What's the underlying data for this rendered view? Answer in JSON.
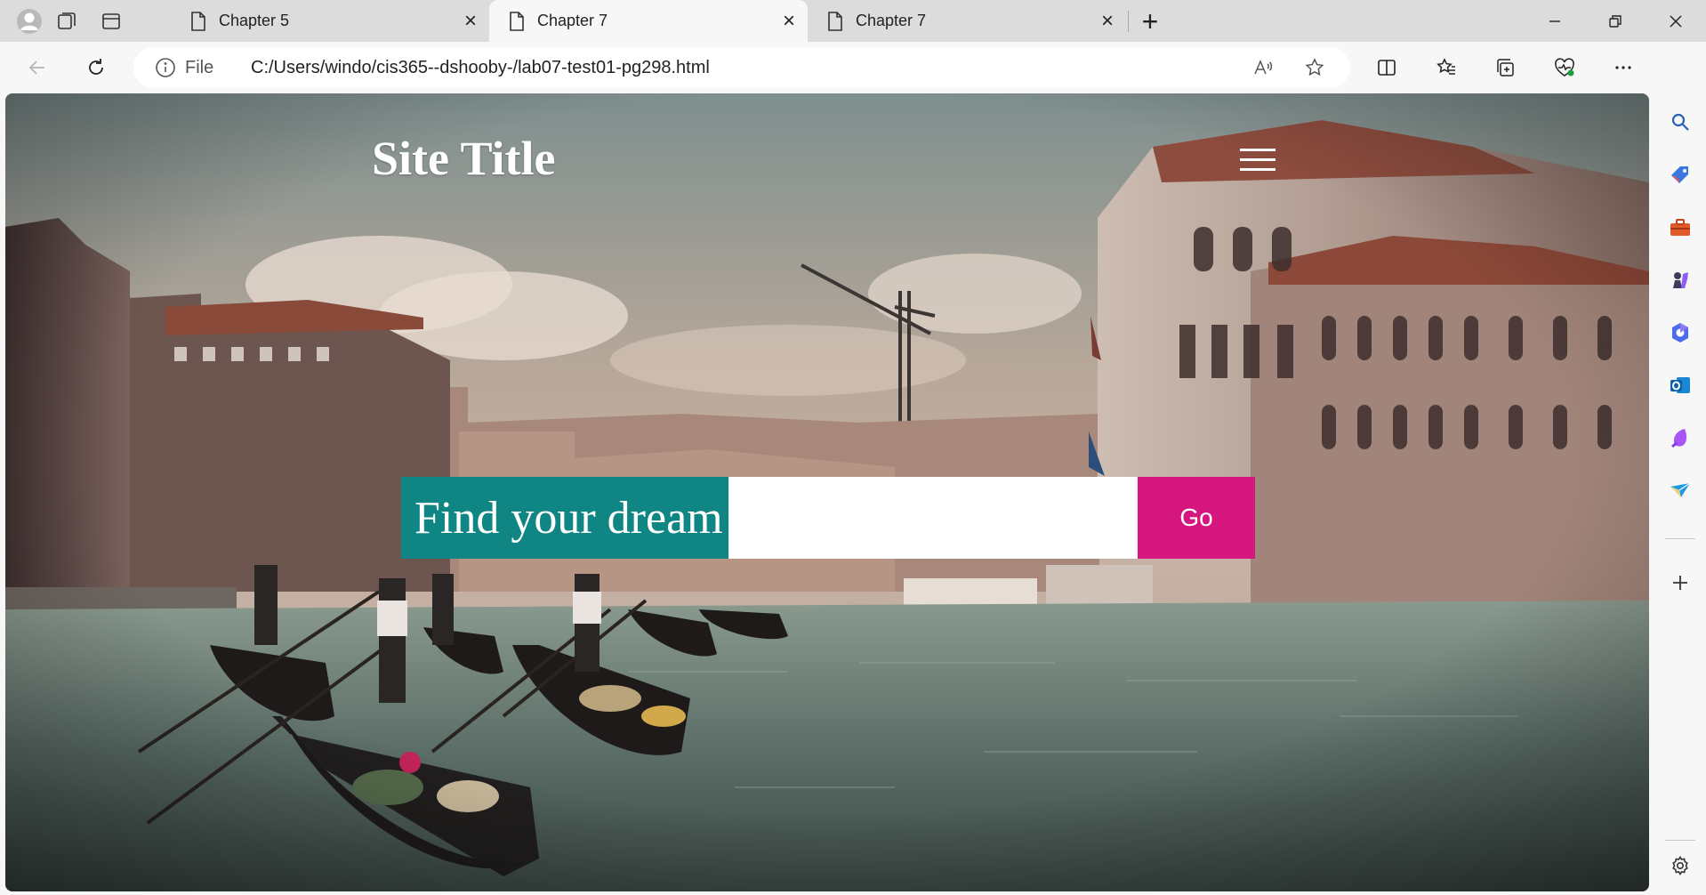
{
  "browser": {
    "tabs": [
      {
        "title": "Chapter 5",
        "active": false
      },
      {
        "title": "Chapter 7",
        "active": true
      },
      {
        "title": "Chapter 7",
        "active": false
      }
    ],
    "address": {
      "scheme_label": "File",
      "url": "C:/Users/windo/cis365--dshooby-/lab07-test01-pg298.html"
    },
    "accent_color": "#1a73e8"
  },
  "page": {
    "site_title": "Site Title",
    "search": {
      "label": "Find your dream",
      "input_value": "",
      "button_label": "Go",
      "label_color": "#0f8684",
      "button_color": "#d6167f"
    },
    "hero_image": "Venice Grand Canal with gondolas"
  },
  "sidebar": {
    "items": [
      "search-icon",
      "tag-icon",
      "toolbox-icon",
      "chess-icon",
      "copilot-icon",
      "outlook-icon",
      "drop-icon",
      "send-icon",
      "add-icon",
      "settings-icon"
    ]
  }
}
